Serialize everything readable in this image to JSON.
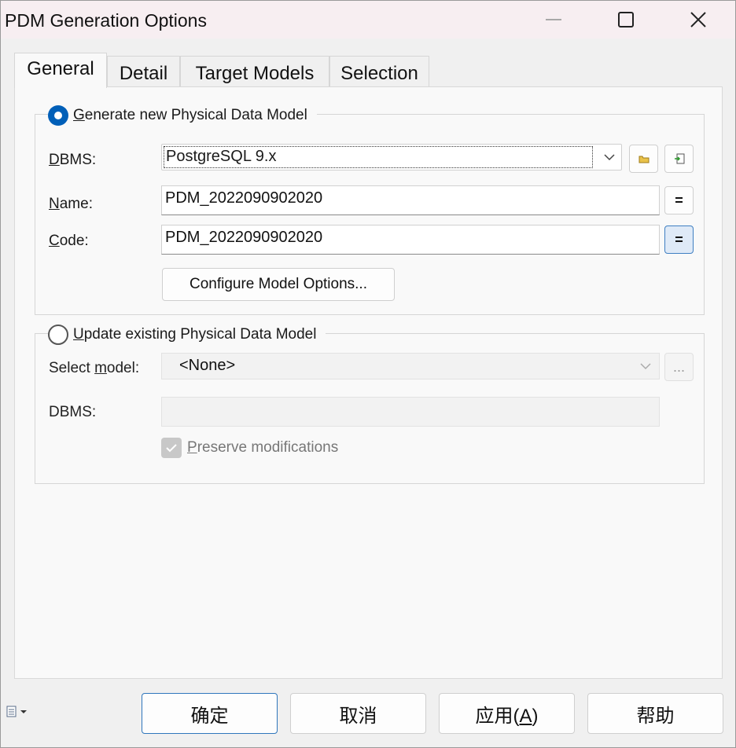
{
  "window": {
    "title": "PDM Generation Options"
  },
  "tabs": [
    {
      "label": "General",
      "active": true
    },
    {
      "label": "Detail",
      "active": false
    },
    {
      "label": "Target Models",
      "active": false
    },
    {
      "label": "Selection",
      "active": false
    }
  ],
  "generate_new": {
    "radio_label": "Generate new Physical Data Model",
    "selected": true,
    "dbms_label": "DBMS:",
    "dbms_value": "PostgreSQL 9.x",
    "name_label": "Name:",
    "name_value": "PDM_2022090902020",
    "code_label": "Code:",
    "code_value": "PDM_2022090902020",
    "equals_button": "=",
    "configure_button": "Configure Model Options..."
  },
  "update_existing": {
    "radio_label": "Update existing Physical Data Model",
    "selected": false,
    "select_model_label": "Select model:",
    "select_model_value": "<None>",
    "browse_button": "...",
    "dbms_label": "DBMS:",
    "dbms_value": "",
    "preserve_label": "Preserve modifications",
    "preserve_checked": true
  },
  "footer": {
    "ok": "确定",
    "cancel": "取消",
    "apply": "应用(A)",
    "help": "帮助"
  },
  "colors": {
    "accent": "#005fb8",
    "title_bar": "#f7eef1",
    "focus_border": "#2f76bc"
  }
}
